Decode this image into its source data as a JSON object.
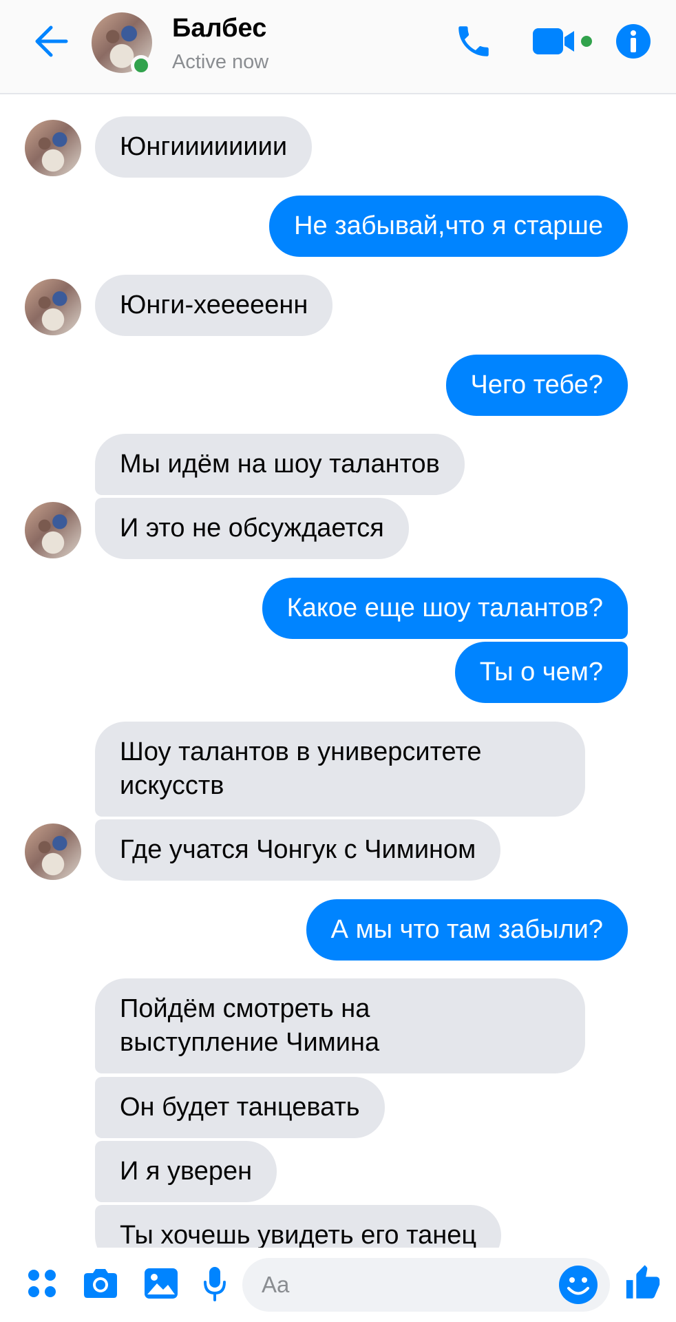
{
  "header": {
    "contact_name": "Балбес",
    "status": "Active now",
    "icons": [
      "arrow-left-icon",
      "phone-icon",
      "video-camera-icon",
      "info-icon"
    ]
  },
  "colors": {
    "accent": "#0084ff",
    "incoming_bubble": "#e4e6eb",
    "online": "#31a24c"
  },
  "messages": [
    {
      "from": "contact",
      "text": "Юнгииииииии"
    },
    {
      "from": "me",
      "text": "Не забывай,что я старше"
    },
    {
      "from": "contact",
      "text": "Юнги-хееееенн"
    },
    {
      "from": "me",
      "text": "Чего тебе?"
    },
    {
      "from": "contact",
      "text": "Мы идём на шоу талантов"
    },
    {
      "from": "contact",
      "text": "И это не обсуждается"
    },
    {
      "from": "me",
      "text": "Какое еще шоу талантов?"
    },
    {
      "from": "me",
      "text": "Ты о чем?"
    },
    {
      "from": "contact",
      "text": "Шоу талантов в университете\nискусств"
    },
    {
      "from": "contact",
      "text": "Где учатся Чонгук с Чимином"
    },
    {
      "from": "me",
      "text": "А мы что там забыли?"
    },
    {
      "from": "contact",
      "text": "Пойдём смотреть на\nвыступление Чимина"
    },
    {
      "from": "contact",
      "text": "Он будет танцевать"
    },
    {
      "from": "contact",
      "text": "И я уверен"
    },
    {
      "from": "contact",
      "text": "Ты хочешь увидеть его танец"
    }
  ],
  "composer": {
    "placeholder": "Aa",
    "icons": [
      "menu-dots-icon",
      "camera-icon",
      "image-icon",
      "microphone-icon",
      "emoji-icon",
      "thumbs-up-icon"
    ]
  }
}
